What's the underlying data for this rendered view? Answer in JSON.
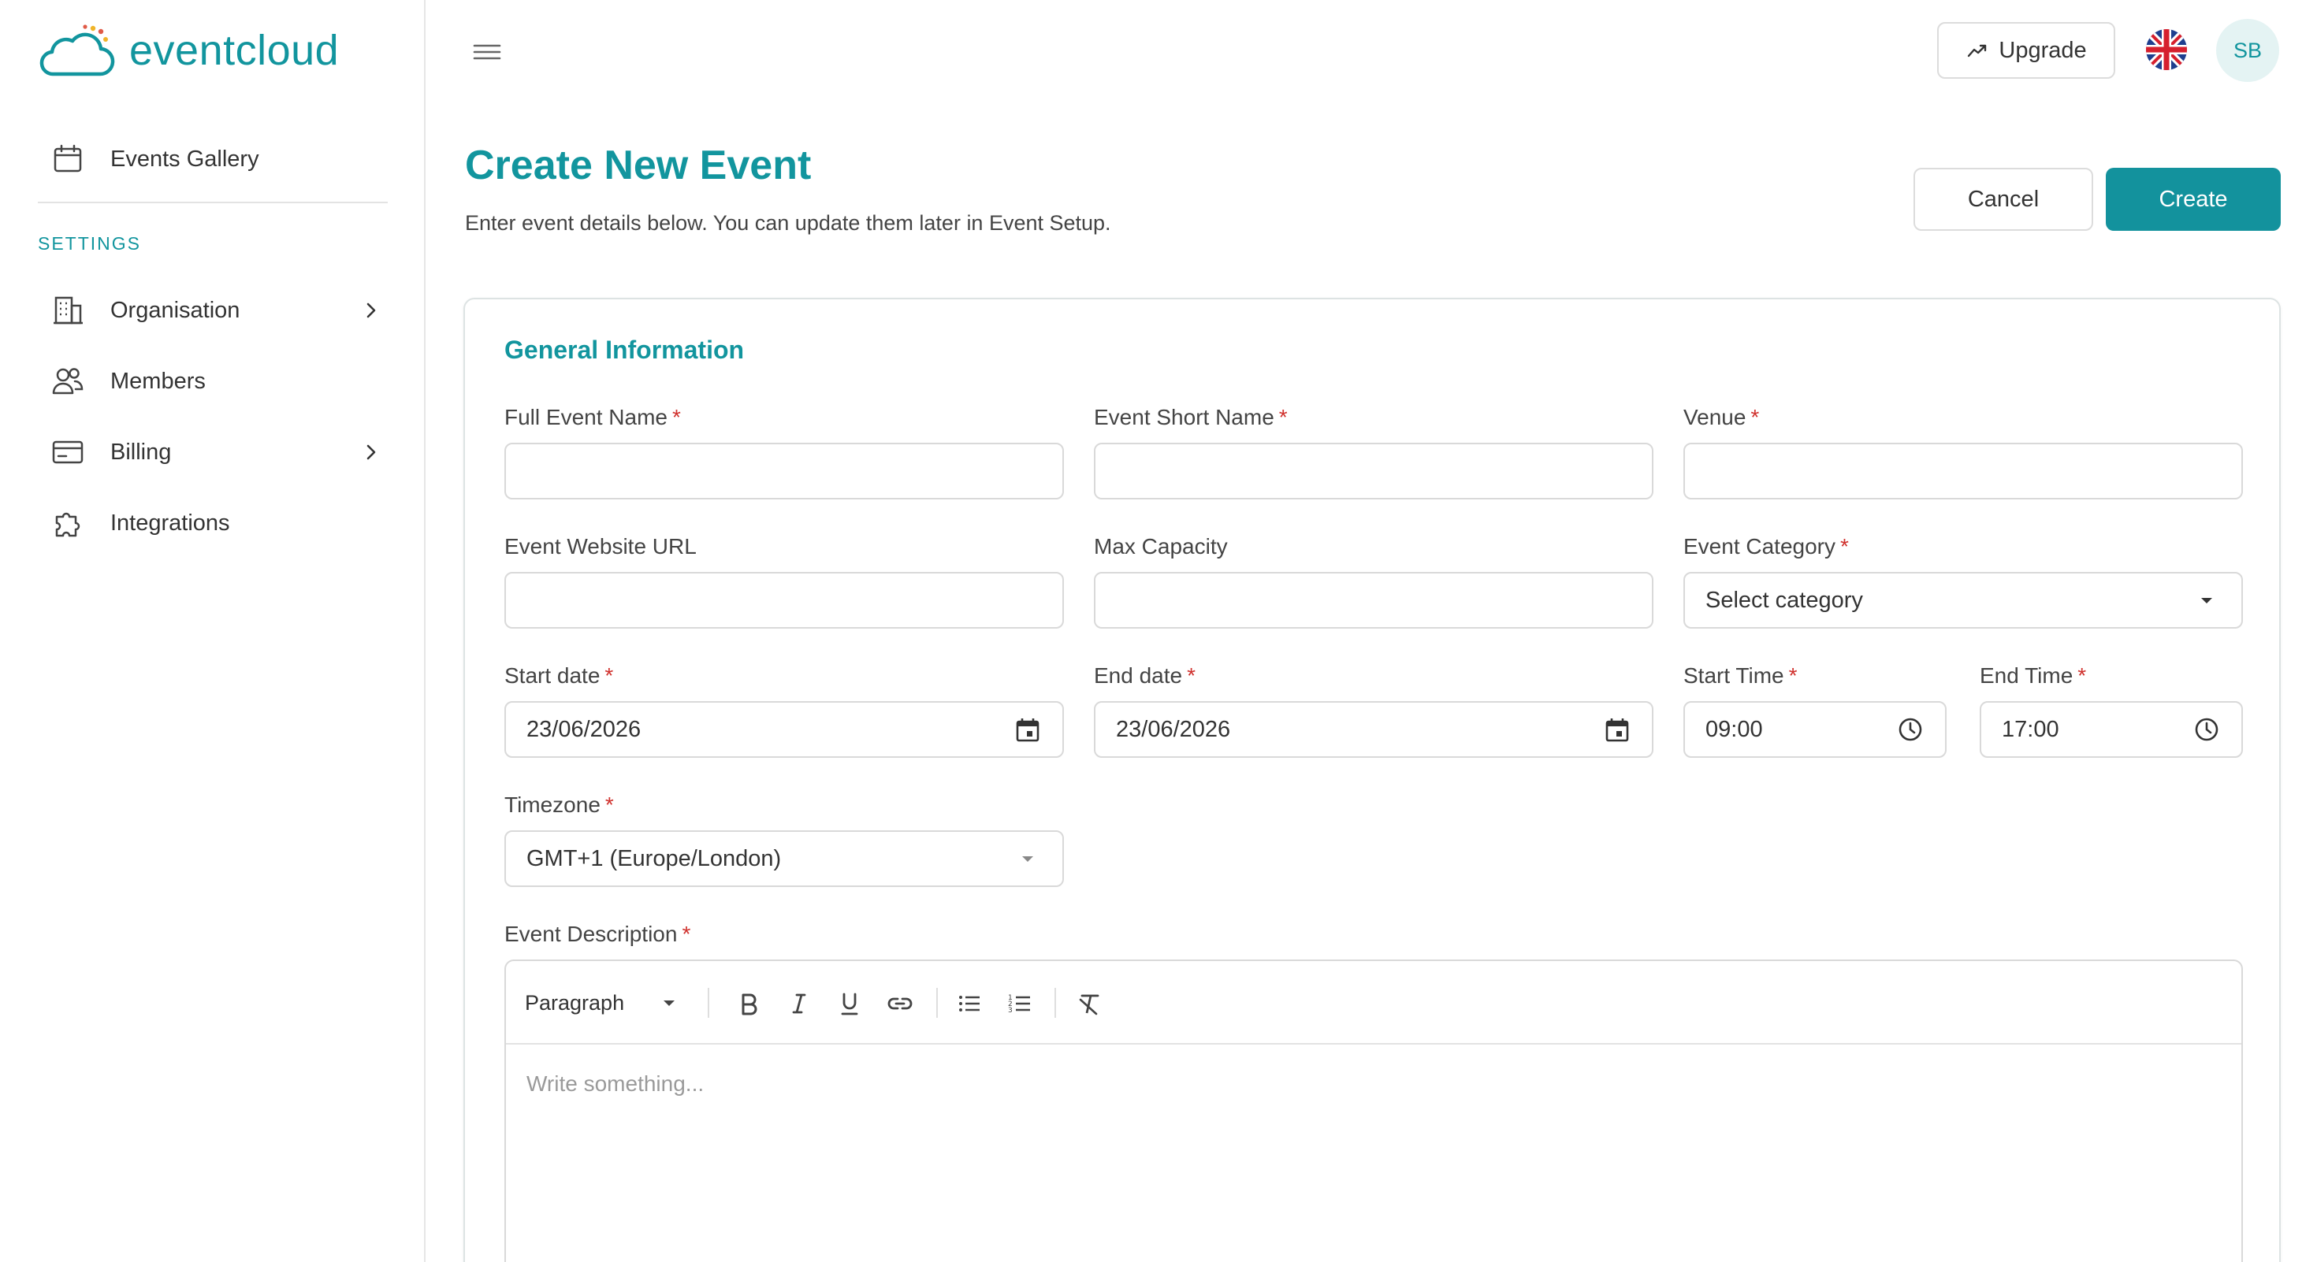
{
  "brand": {
    "name": "eventcloud",
    "color": "#12959e"
  },
  "sidebar": {
    "events_gallery": {
      "label": "Events Gallery",
      "icon": "calendar-icon"
    },
    "section_label": "SETTINGS",
    "items": [
      {
        "label": "Organisation",
        "icon": "building-icon",
        "has_submenu": true
      },
      {
        "label": "Members",
        "icon": "users-icon",
        "has_submenu": false
      },
      {
        "label": "Billing",
        "icon": "credit-card-icon",
        "has_submenu": true
      },
      {
        "label": "Integrations",
        "icon": "puzzle-icon",
        "has_submenu": false
      }
    ]
  },
  "topbar": {
    "upgrade_label": "Upgrade",
    "language_flag": "uk-flag-icon",
    "avatar_initials": "SB"
  },
  "page": {
    "title": "Create New Event",
    "subtitle": "Enter event details below. You can update them later in Event Setup.",
    "cancel_label": "Cancel",
    "create_label": "Create"
  },
  "form": {
    "section_title": "General Information",
    "full_event_name": {
      "label": "Full Event Name",
      "required": true,
      "value": ""
    },
    "event_short_name": {
      "label": "Event Short Name",
      "required": true,
      "value": ""
    },
    "venue": {
      "label": "Venue",
      "required": true,
      "value": ""
    },
    "event_website_url": {
      "label": "Event Website URL",
      "required": false,
      "value": ""
    },
    "max_capacity": {
      "label": "Max Capacity",
      "required": false,
      "value": ""
    },
    "event_category": {
      "label": "Event Category",
      "required": true,
      "value": "Select category"
    },
    "start_date": {
      "label": "Start date",
      "required": true,
      "value": "23/06/2026"
    },
    "end_date": {
      "label": "End date",
      "required": true,
      "value": "23/06/2026"
    },
    "start_time": {
      "label": "Start Time",
      "required": true,
      "value": "09:00"
    },
    "end_time": {
      "label": "End Time",
      "required": true,
      "value": "17:00"
    },
    "timezone": {
      "label": "Timezone",
      "required": true,
      "value": "GMT+1 (Europe/London)"
    },
    "event_description": {
      "label": "Event Description",
      "required": true,
      "block_format": "Paragraph",
      "placeholder": "Write something..."
    },
    "required_mark": "*"
  },
  "colors": {
    "accent": "#13929d",
    "required": "#d0312d",
    "border": "#d9d9d9"
  }
}
